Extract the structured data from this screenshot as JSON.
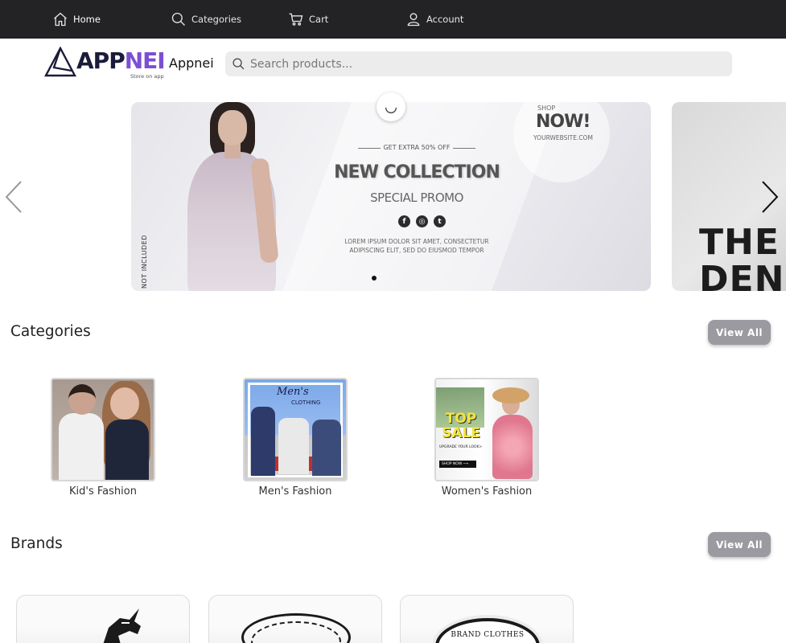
{
  "nav": {
    "home": {
      "label": "Home",
      "icon": "home-icon"
    },
    "categories": {
      "label": "Categories",
      "icon": "search-icon"
    },
    "cart": {
      "label": "Cart",
      "icon": "cart-icon"
    },
    "account": {
      "label": "Account",
      "icon": "user-icon"
    }
  },
  "header": {
    "logo_text_a": "APP",
    "logo_text_b": "NEI",
    "logo_tagline": "Store on app",
    "app_name": "Appnei"
  },
  "search": {
    "placeholder": "Search products...",
    "value": ""
  },
  "carousel": {
    "vertical_text": "NOT INCLUDED",
    "pre_title": "GET EXTRA 50% OFF",
    "title": "NEW COLLECTION",
    "subtitle": "SPECIAL PROMO",
    "lorem": "LOREM IPSUM DOLOR SIT AMET, CONSECTETUR ADIPISCING ELIT, SED DO EIUSMOD TEMPOR",
    "shop_pre": "SHOP",
    "shop_now": "NOW!",
    "shop_site": "YOURWEBSITE.COM",
    "socials": [
      "f",
      "◎",
      "t"
    ],
    "next_slide_text": "THE DEN"
  },
  "categories": {
    "title": "Categories",
    "view_all": "View All",
    "items": [
      {
        "label": "Kid's Fashion"
      },
      {
        "label": "Men's Fashion",
        "image_title": "Men's",
        "image_sub": "CLOTHING"
      },
      {
        "label": "Women's Fashion",
        "image_title": "TOP SALE",
        "image_sub": "UPGRADE YOUR LOOK>",
        "image_button": "SHOP NOW ⟶"
      }
    ]
  },
  "brands": {
    "title": "Brands",
    "view_all": "View All",
    "items": [
      {
        "name": "unicorn-brand"
      },
      {
        "name": "greek-key-brand"
      },
      {
        "label": "BRAND CLOTHES"
      }
    ]
  },
  "colors": {
    "nav_bg": "#232326",
    "accent": "#7b4fd3",
    "view_all_bg": "#9a9aa0"
  }
}
